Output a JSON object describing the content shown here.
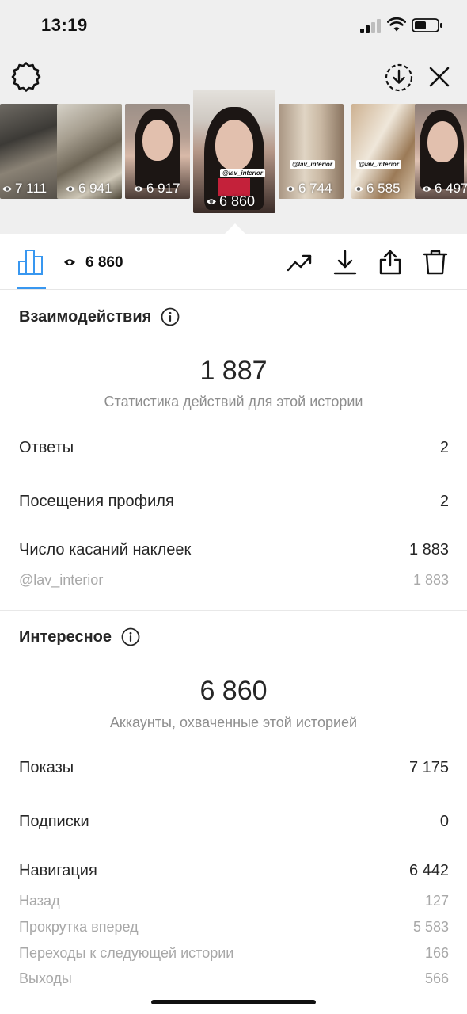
{
  "status_bar": {
    "time": "13:19"
  },
  "thumbnails": [
    {
      "views": "7 111",
      "tag": ""
    },
    {
      "views": "6 941",
      "tag": ""
    },
    {
      "views": "6 917",
      "tag": ""
    },
    {
      "views": "6 860",
      "tag": "@lav_interior"
    },
    {
      "views": "6 744",
      "tag": "@lav_interior"
    },
    {
      "views": "6 585",
      "tag": "@lav_interior"
    },
    {
      "views": "6 497",
      "tag": ""
    }
  ],
  "toolbar": {
    "views": "6 860"
  },
  "interactions": {
    "title": "Взаимодействия",
    "total": "1 887",
    "caption": "Статистика действий для этой истории",
    "rows": [
      {
        "label": "Ответы",
        "value": "2"
      },
      {
        "label": "Посещения профиля",
        "value": "2"
      },
      {
        "label": "Число касаний наклеек",
        "value": "1 883"
      }
    ],
    "sub_rows": [
      {
        "label": "@lav_interior",
        "value": "1 883"
      }
    ]
  },
  "discovery": {
    "title": "Интересное",
    "total": "6 860",
    "caption": "Аккаунты, охваченные этой историей",
    "rows": [
      {
        "label": "Показы",
        "value": "7 175"
      },
      {
        "label": "Подписки",
        "value": "0"
      },
      {
        "label": "Навигация",
        "value": "6 442"
      }
    ],
    "sub_rows": [
      {
        "label": "Назад",
        "value": "127"
      },
      {
        "label": "Прокрутка вперед",
        "value": "5 583"
      },
      {
        "label": "Переходы к следующей истории",
        "value": "166"
      },
      {
        "label": "Выходы",
        "value": "566"
      }
    ]
  },
  "colors": {
    "accent": "#3897f0",
    "text": "#262626",
    "muted": "#8e8e8e"
  },
  "icons": [
    "gear-icon",
    "download-circle-icon",
    "close-icon",
    "bar-chart-icon",
    "eye-icon",
    "trend-icon",
    "download-icon",
    "share-icon",
    "trash-icon",
    "info-icon"
  ]
}
